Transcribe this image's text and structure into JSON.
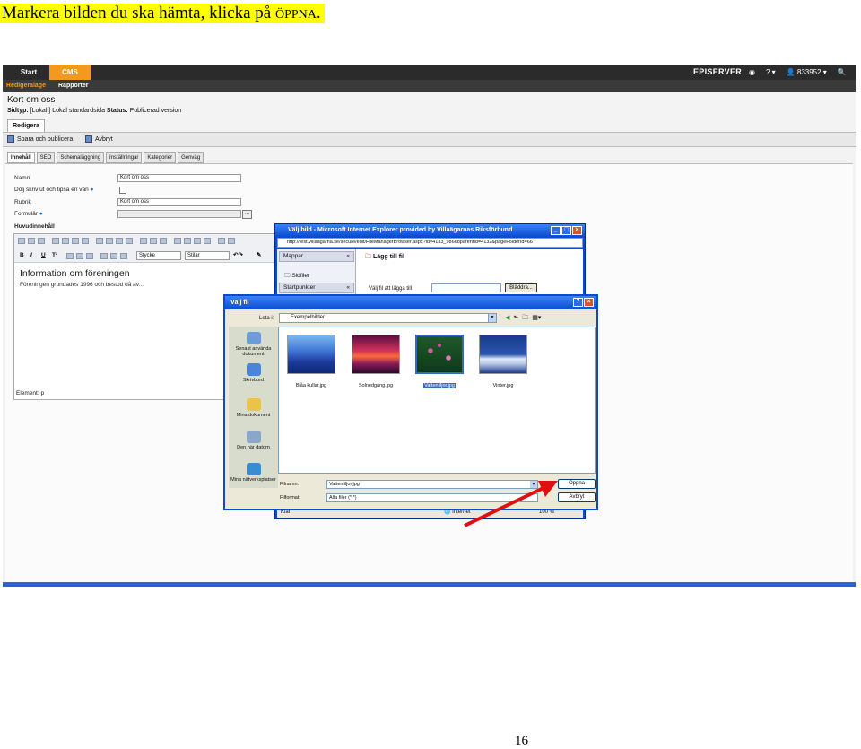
{
  "instruction": {
    "text_main": "Markera bilden du ska hämta, klicka på ",
    "text_caps": "ÖPPNA",
    "text_end": "."
  },
  "page_number": "16",
  "cms": {
    "tabs": [
      "Start",
      "CMS"
    ],
    "brand": "EPISERVER",
    "user": "833952",
    "help": "?",
    "sub_tabs": [
      "Redigeraläge",
      "Rapporter"
    ],
    "page_title": "Kort om oss",
    "page_meta_label1": "Sidtyp:",
    "page_meta_val1": "[Lokalt] Lokal standardsida",
    "page_meta_label2": "Status:",
    "page_meta_val2": "Publicerad version",
    "edit_tab": "Redigera",
    "save_publish": "Spara och publicera",
    "cancel": "Avbryt",
    "inner_tabs": [
      "Innehåll",
      "SEO",
      "Schemaläggning",
      "Inställningar",
      "Kategorier",
      "Genväg"
    ],
    "fields": {
      "namn_label": "Namn",
      "namn_value": "Kort om oss",
      "dolj_label": "Dölj skriv ut och tipsa en vän",
      "rubrik_label": "Rubrik",
      "rubrik_value": "Kort om oss",
      "formular_label": "Formulär",
      "formular_button": "...",
      "huvud_label": "Huvudinnehåll"
    },
    "editor": {
      "style_select": "Stycke",
      "format_select": "Stilar",
      "heading": "Information om föreningen",
      "body": "Föreningen grundades 1996 och bestod då av...",
      "footer": "Element: p",
      "bold": "B",
      "italic": "I",
      "underline": "U",
      "superscript": "T²"
    }
  },
  "ie_window": {
    "title": "Välj bild - Microsoft Internet Explorer provided by Villaägarnas Riksförbund",
    "address": "http://test.villaagarna.se/secure/edit/FileManagerBrowser.aspx?id=4133_98668parentId=4132&pageFolderId=66",
    "left_bar1": "Mappar",
    "left_bar2": "Startpunkter",
    "sidfiler": "Sidfiler",
    "right_title": "Lägg till fil",
    "choose_label": "Välj fil att lägga till",
    "browse": "Bläddra...",
    "status_left": "Klar",
    "status_zone": "Internet",
    "status_zoom": "100 %"
  },
  "file_dialog": {
    "title": "Välj fil",
    "look_in_label": "Leta i:",
    "look_in_value": "Exempelbilder",
    "places": [
      "Senast använda dokument",
      "Skrivbord",
      "Mina dokument",
      "Den här datorn",
      "Mina nätverksplatser"
    ],
    "files": [
      "Blåa kullar.jpg",
      "Solnedgång.jpg",
      "Vattenliljor.jpg",
      "Vinter.jpg"
    ],
    "selected_index": 2,
    "filename_label": "Filnamn:",
    "filename_value": "Vattenliljor.jpg",
    "filetype_label": "Filformat:",
    "filetype_value": "Alla filer (*.*)",
    "open_button": "Öppna",
    "cancel_button": "Avbryt"
  },
  "colors": {
    "highlight": "#ffff00",
    "cms_accent": "#f29a1d",
    "xp_blue": "#0a4bd1",
    "arrow": "#e01010"
  }
}
